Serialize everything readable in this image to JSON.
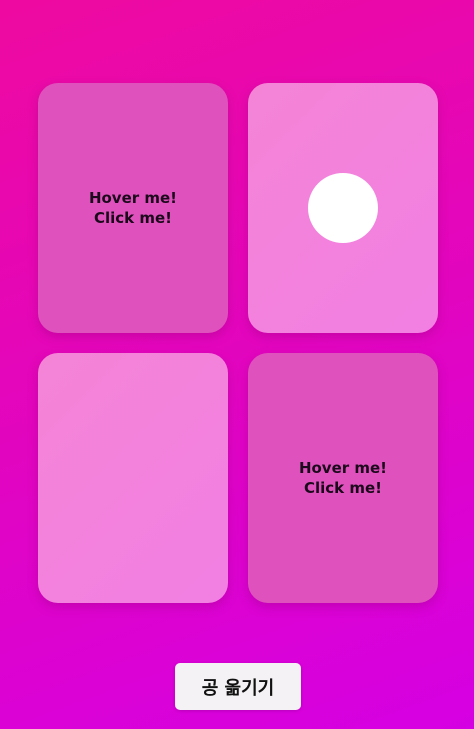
{
  "cards": [
    {
      "label_line1": "Hover me!",
      "label_line2": "Click me!",
      "has_ball": false
    },
    {
      "label_line1": "",
      "label_line2": "",
      "has_ball": true
    },
    {
      "label_line1": "",
      "label_line2": "",
      "has_ball": false
    },
    {
      "label_line1": "Hover me!",
      "label_line2": "Click me!",
      "has_ball": false
    }
  ],
  "move_button": {
    "label": "공 옮기기"
  },
  "colors": {
    "background_start": "#ee0aa0",
    "background_end": "#d500e3",
    "card_dark": "#df52bd",
    "card_light": "#f484d6",
    "ball": "#ffffff"
  }
}
